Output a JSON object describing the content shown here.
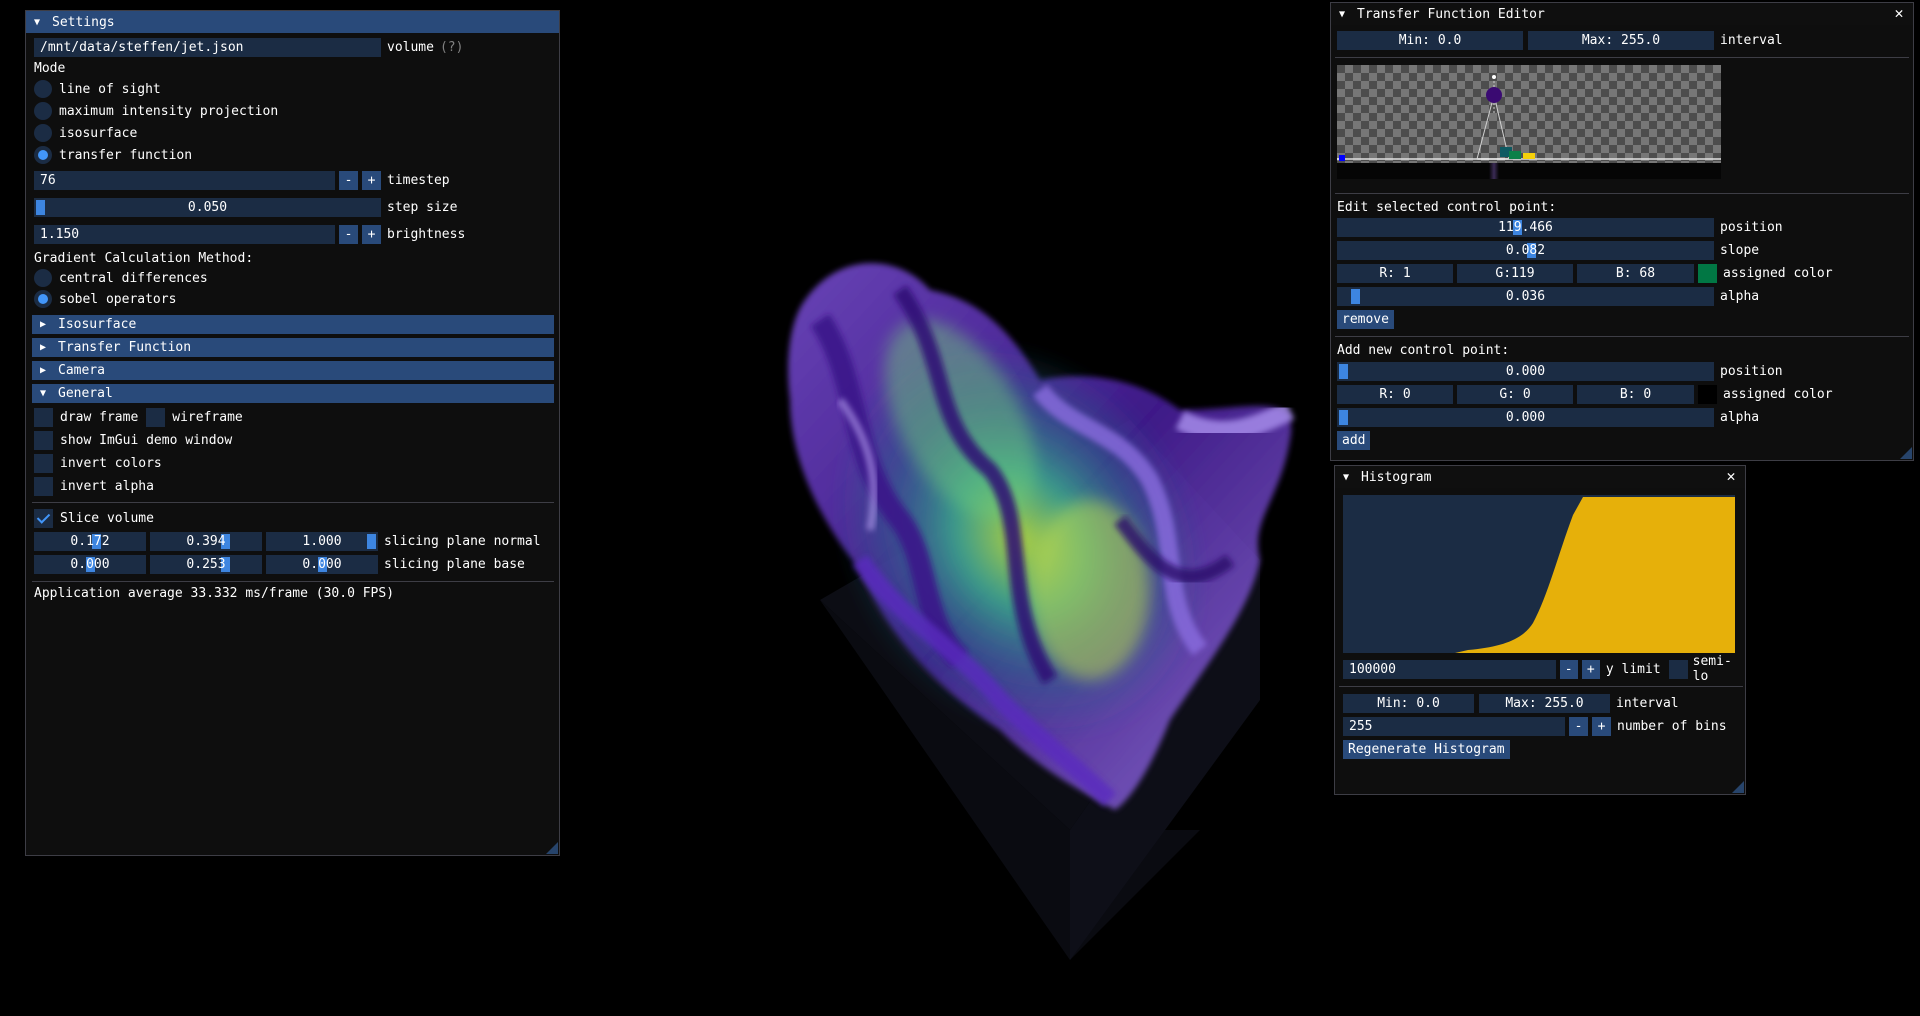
{
  "colors": {
    "accent": "#4296fa",
    "title_active": "#294a7a",
    "frame_bg": "#1b2c44",
    "histogram_fill": "#e6b00a"
  },
  "settings": {
    "title": "Settings",
    "volume_path": "/mnt/data/steffen/jet.json",
    "volume_label": "volume",
    "volume_help": "(?)",
    "mode_label": "Mode",
    "modes": [
      "line of sight",
      "maximum intensity projection",
      "isosurface",
      "transfer function"
    ],
    "selected_mode": "transfer function",
    "timestep": {
      "value": "76",
      "label": "timestep",
      "minus": "-",
      "plus": "+"
    },
    "step_size": {
      "value": "0.050",
      "label": "step size",
      "fraction": 0.0
    },
    "brightness": {
      "value": "1.150",
      "label": "brightness",
      "minus": "-",
      "plus": "+"
    },
    "gradient_label": "Gradient Calculation Method:",
    "gradient_methods": [
      "central differences",
      "sobel operators"
    ],
    "selected_gradient": "sobel operators",
    "sections": [
      "Isosurface",
      "Transfer Function",
      "Camera",
      "General"
    ],
    "general": {
      "draw_frame": "draw frame",
      "wireframe": "wireframe",
      "show_demo": "show ImGui demo window",
      "invert_colors": "invert colors",
      "invert_alpha": "invert alpha"
    },
    "slice_volume": {
      "label": "Slice volume",
      "checked": true
    },
    "slicing_normal": {
      "values": [
        "0.172",
        "0.394",
        "1.000"
      ],
      "label": "slicing plane normal"
    },
    "slicing_base": {
      "values": [
        "0.000",
        "0.253",
        "0.000"
      ],
      "label": "slicing plane base"
    },
    "fps_text": "Application average 33.332 ms/frame (30.0 FPS)"
  },
  "tf_editor": {
    "title": "Transfer Function Editor",
    "close": "✕",
    "min": "Min: 0.0",
    "max": "Max: 255.0",
    "interval_label": "interval",
    "edit_label": "Edit selected control point:",
    "position": {
      "value": "119.466",
      "label": "position"
    },
    "slope": {
      "value": "0.082",
      "label": "slope"
    },
    "color": {
      "r": "R:  1",
      "g": "G:119",
      "b": "B: 68",
      "label": "assigned color",
      "swatch": "#017744"
    },
    "alpha": {
      "value": "0.036",
      "label": "alpha"
    },
    "remove": "remove",
    "add_label": "Add new control point:",
    "new_position": {
      "value": "0.000",
      "label": "position"
    },
    "new_color": {
      "r": "R:  0",
      "g": "G:  0",
      "b": "B:  0",
      "label": "assigned color",
      "swatch": "#000000"
    },
    "new_alpha": {
      "value": "0.000",
      "label": "alpha"
    },
    "add": "add"
  },
  "histogram": {
    "title": "Histogram",
    "close": "✕",
    "y_limit": {
      "value": "100000",
      "label": "y limit",
      "minus": "-",
      "plus": "+"
    },
    "semi_log": "semi-lo",
    "min": "Min: 0.0",
    "max": "Max: 255.0",
    "interval_label": "interval",
    "bins": {
      "value": "255",
      "label": "number of bins",
      "minus": "-",
      "plus": "+"
    },
    "regenerate": "Regenerate Histogram"
  }
}
